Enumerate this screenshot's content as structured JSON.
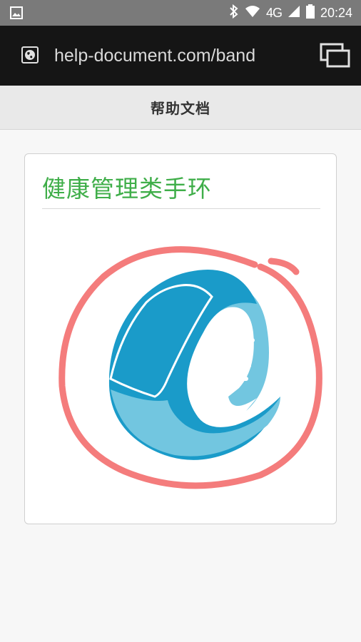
{
  "status_bar": {
    "network": "4G",
    "time": "20:24",
    "icons": [
      "image-notification-icon",
      "bluetooth-icon",
      "wifi-icon",
      "signal-icon",
      "battery-icon"
    ]
  },
  "browser": {
    "url": "help-document.com/band",
    "icons": [
      "globe-icon",
      "tabs-icon"
    ]
  },
  "page": {
    "title": "帮助文档"
  },
  "card": {
    "heading": "健康管理类手环",
    "illustration": "wristband-illustration",
    "colors": {
      "heading": "#3fae49",
      "band_dark": "#1a9bc9",
      "band_light": "#72c6e0",
      "circle_annotation": "#f47c7c"
    }
  }
}
